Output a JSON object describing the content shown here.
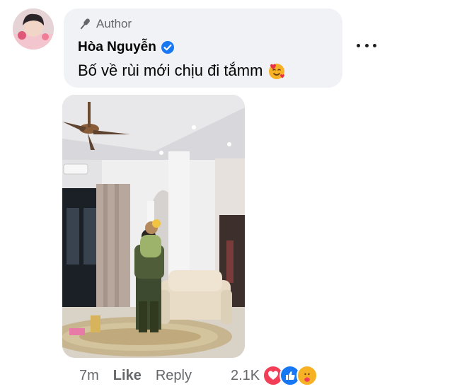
{
  "comment": {
    "badge": "Author",
    "author_name": "Hòa Nguyễn",
    "text": "Bố về rùi mới chịu đi tắmm",
    "emoji_icon": "smiling-face-with-hearts-icon"
  },
  "actions": {
    "time": "7m",
    "like_label": "Like",
    "reply_label": "Reply",
    "reaction_count": "2.1K"
  },
  "colors": {
    "bubble": "#f0f2f5",
    "verified": "#1877f2",
    "like_reaction": "#1877f2",
    "love_reaction": "#f33e58",
    "care_reaction": "#f7b125",
    "secondary_text": "#65676b"
  }
}
